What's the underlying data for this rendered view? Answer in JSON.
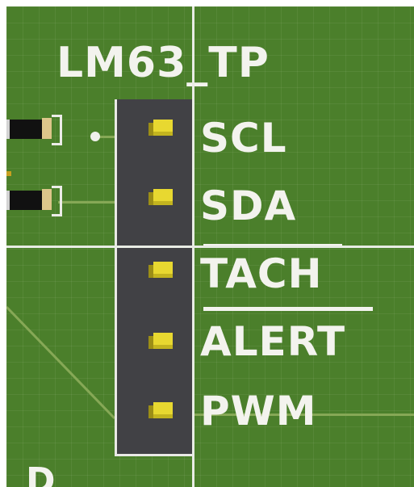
{
  "component": {
    "designator": "LM63_TP",
    "pins": [
      {
        "label": "SCL",
        "overbar": false
      },
      {
        "label": "SDA",
        "overbar": false
      },
      {
        "label": "TACH",
        "overbar": true
      },
      {
        "label": "ALERT",
        "overbar": true
      },
      {
        "label": "PWM",
        "overbar": false
      }
    ]
  },
  "edge_text": {
    "partial_label": "D"
  },
  "colors": {
    "board": "#4b7f2b",
    "silkscreen": "#f3f3ee",
    "header_body": "#414145",
    "pad": "#e8d830",
    "trace": "#86a856",
    "crosshair": "#e8ece4"
  }
}
